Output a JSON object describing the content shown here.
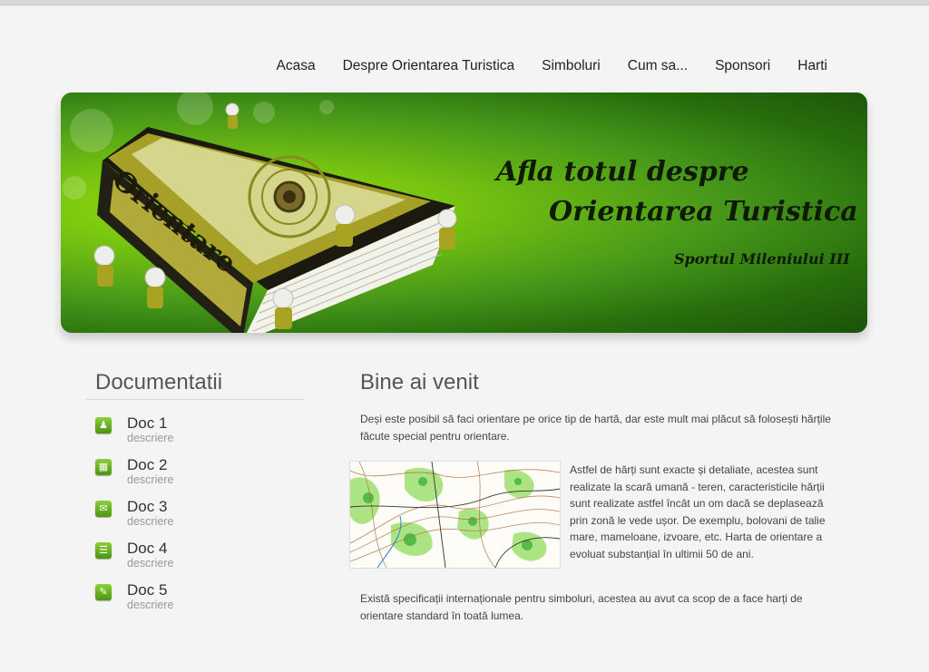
{
  "nav": {
    "items": [
      "Acasa",
      "Despre Orientarea Turistica",
      "Simboluri",
      "Cum sa...",
      "Sponsori",
      "Harti"
    ]
  },
  "banner": {
    "title_line1": "Afla totul despre",
    "title_line2": "Orientarea Turistica",
    "subtitle": "Sportul Mileniului III",
    "book_spine_text": "Orientare",
    "accent_color": "#77c410"
  },
  "sidebar": {
    "title": "Documentatii",
    "docs": [
      {
        "title": "Doc 1",
        "desc": "descriere",
        "icon": "person-icon"
      },
      {
        "title": "Doc 2",
        "desc": "descriere",
        "icon": "calendar-icon"
      },
      {
        "title": "Doc 3",
        "desc": "descriere",
        "icon": "mail-icon"
      },
      {
        "title": "Doc 4",
        "desc": "descriere",
        "icon": "document-icon"
      },
      {
        "title": "Doc 5",
        "desc": "descriere",
        "icon": "pencil-icon"
      }
    ]
  },
  "main": {
    "title": "Bine ai venit",
    "p1": "Deși este posibil să faci orientare pe orice tip de hartă, dar este mult mai plăcut să folosești hărțile făcute special pentru orientare.",
    "p2": "Astfel de hărți sunt exacte și detaliate, acestea sunt realizate la scară umană - teren, caracteristicile hărții sunt realizate astfel încât un om dacă se deplasează prin zonă le vede ușor. De exemplu, bolovani de talie mare, mameloane, izvoare, etc. Harta de orientare a evoluat substanțial în ultimii 50 de ani.",
    "p3": "Există specificații internaționale pentru simboluri, acestea au avut ca scop de a face harți de orientare standard în toată lumea."
  }
}
